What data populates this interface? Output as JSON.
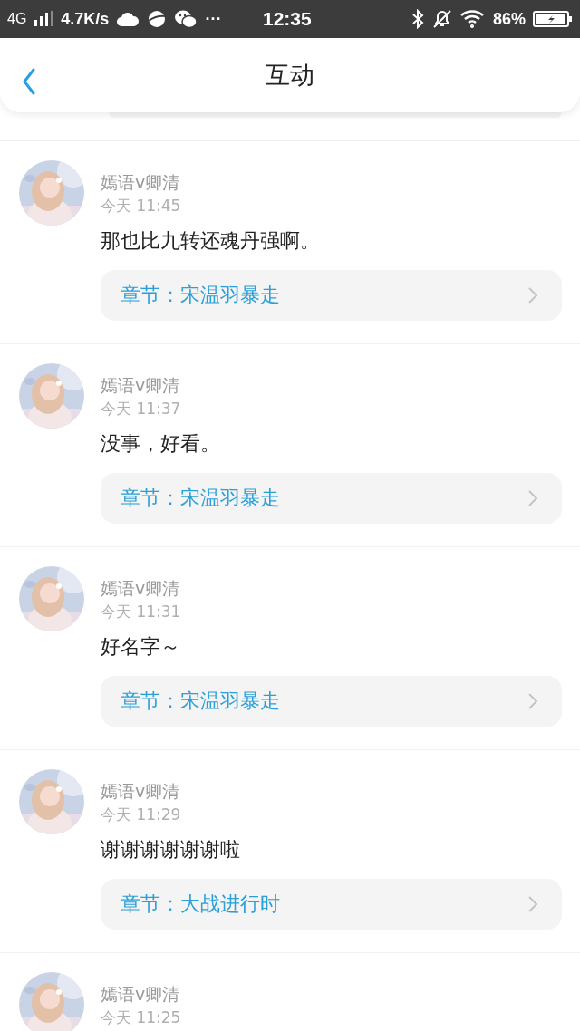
{
  "status_bar": {
    "network": "4G",
    "speed": "4.7K/s",
    "more": "···",
    "time": "12:35",
    "battery": "86%"
  },
  "header": {
    "title": "互动"
  },
  "comments": [
    {
      "name": "嫣语v卿清",
      "time": "今天 11:45",
      "text": "那也比九转还魂丹强啊。",
      "chapter": "章节：宋温羽暴走"
    },
    {
      "name": "嫣语v卿清",
      "time": "今天 11:37",
      "text": "没事，好看。",
      "chapter": "章节：宋温羽暴走"
    },
    {
      "name": "嫣语v卿清",
      "time": "今天 11:31",
      "text": "好名字～",
      "chapter": "章节：宋温羽暴走"
    },
    {
      "name": "嫣语v卿清",
      "time": "今天 11:29",
      "text": "谢谢谢谢谢谢啦",
      "chapter": "章节：大战进行时"
    },
    {
      "name": "嫣语v卿清",
      "time": "今天 11:25"
    }
  ]
}
